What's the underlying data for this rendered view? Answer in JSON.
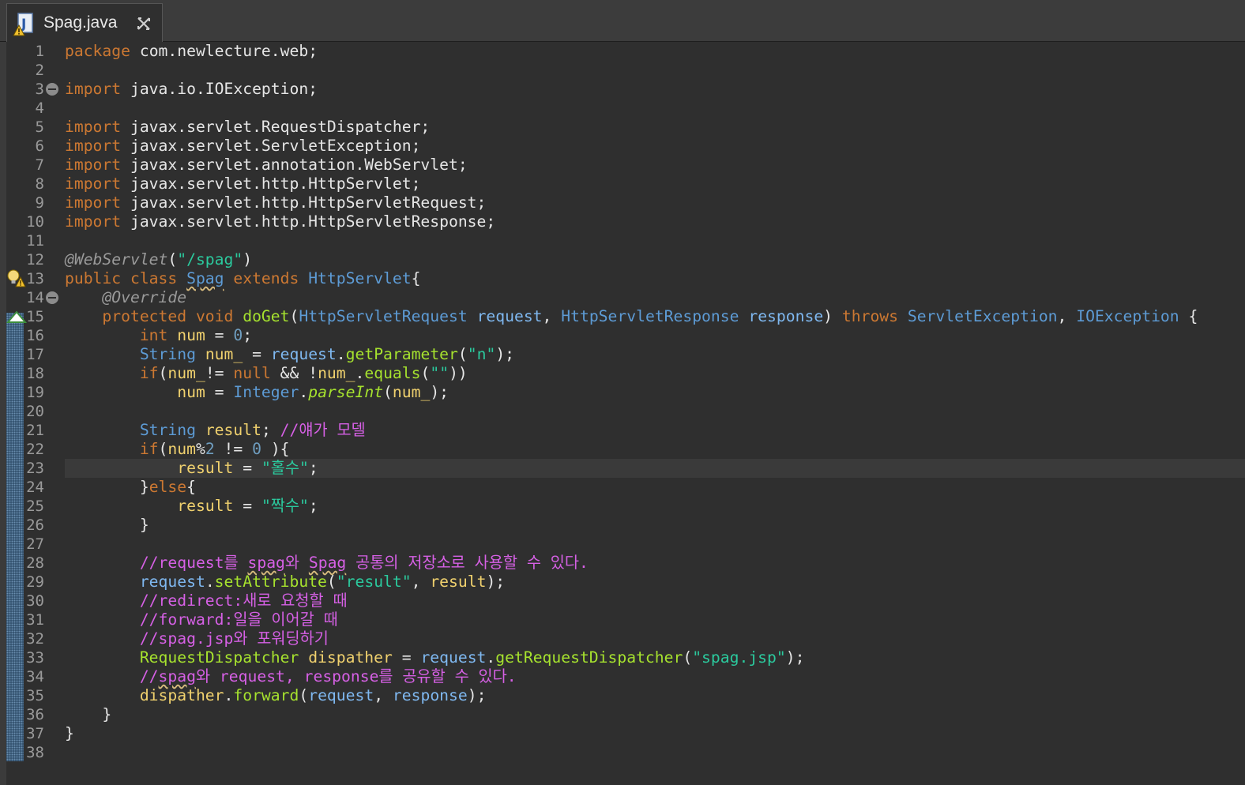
{
  "tab": {
    "title": "Spag.java",
    "icon": "java-file-warning-icon",
    "close_icon": "close-icon"
  },
  "editor": {
    "current_line": 23,
    "lines": [
      {
        "n": "1",
        "segs": [
          {
            "t": "package",
            "c": "kw"
          },
          {
            "t": " com.newlecture.web;",
            "c": ""
          }
        ]
      },
      {
        "n": "2",
        "segs": []
      },
      {
        "n": "3",
        "fold": true,
        "segs": [
          {
            "t": "import",
            "c": "kw"
          },
          {
            "t": " java.io.IOException;",
            "c": ""
          }
        ]
      },
      {
        "n": "4",
        "segs": []
      },
      {
        "n": "5",
        "segs": [
          {
            "t": "import",
            "c": "kw"
          },
          {
            "t": " javax.servlet.RequestDispatcher;",
            "c": ""
          }
        ]
      },
      {
        "n": "6",
        "segs": [
          {
            "t": "import",
            "c": "kw"
          },
          {
            "t": " javax.servlet.ServletException;",
            "c": ""
          }
        ]
      },
      {
        "n": "7",
        "segs": [
          {
            "t": "import",
            "c": "kw"
          },
          {
            "t": " javax.servlet.annotation.WebServlet;",
            "c": ""
          }
        ]
      },
      {
        "n": "8",
        "segs": [
          {
            "t": "import",
            "c": "kw"
          },
          {
            "t": " javax.servlet.http.HttpServlet;",
            "c": ""
          }
        ]
      },
      {
        "n": "9",
        "segs": [
          {
            "t": "import",
            "c": "kw"
          },
          {
            "t": " javax.servlet.http.HttpServletRequest;",
            "c": ""
          }
        ]
      },
      {
        "n": "10",
        "segs": [
          {
            "t": "import",
            "c": "kw"
          },
          {
            "t": " javax.servlet.http.HttpServletResponse;",
            "c": ""
          }
        ]
      },
      {
        "n": "11",
        "segs": []
      },
      {
        "n": "12",
        "segs": [
          {
            "t": "@WebServlet",
            "c": "an"
          },
          {
            "t": "(",
            "c": ""
          },
          {
            "t": "\"/spag\"",
            "c": "st"
          },
          {
            "t": ")",
            "c": ""
          }
        ]
      },
      {
        "n": "13",
        "warn": true,
        "segs": [
          {
            "t": "public class ",
            "c": "kw"
          },
          {
            "t": "Spag",
            "c": "ty ul"
          },
          {
            "t": " extends ",
            "c": "kw"
          },
          {
            "t": "HttpServlet",
            "c": "ty"
          },
          {
            "t": "{",
            "c": ""
          }
        ]
      },
      {
        "n": "14",
        "fold": true,
        "segs": [
          {
            "t": "    ",
            "c": ""
          },
          {
            "t": "@Override",
            "c": "an"
          }
        ]
      },
      {
        "n": "15",
        "override": true,
        "segs": [
          {
            "t": "    ",
            "c": ""
          },
          {
            "t": "protected void ",
            "c": "kw"
          },
          {
            "t": "doGet",
            "c": "fn"
          },
          {
            "t": "(",
            "c": ""
          },
          {
            "t": "HttpServletRequest",
            "c": "ty"
          },
          {
            "t": " ",
            "c": ""
          },
          {
            "t": "request",
            "c": "pa"
          },
          {
            "t": ", ",
            "c": ""
          },
          {
            "t": "HttpServletResponse",
            "c": "ty"
          },
          {
            "t": " ",
            "c": ""
          },
          {
            "t": "response",
            "c": "pa"
          },
          {
            "t": ") ",
            "c": ""
          },
          {
            "t": "throws ",
            "c": "kw"
          },
          {
            "t": "ServletException",
            "c": "ty"
          },
          {
            "t": ", ",
            "c": ""
          },
          {
            "t": "IOException",
            "c": "ty"
          },
          {
            "t": " {",
            "c": ""
          }
        ]
      },
      {
        "n": "16",
        "segs": [
          {
            "t": "        ",
            "c": ""
          },
          {
            "t": "int",
            "c": "kw"
          },
          {
            "t": " ",
            "c": ""
          },
          {
            "t": "num",
            "c": "id"
          },
          {
            "t": " = ",
            "c": ""
          },
          {
            "t": "0",
            "c": "nm"
          },
          {
            "t": ";",
            "c": ""
          }
        ]
      },
      {
        "n": "17",
        "segs": [
          {
            "t": "        ",
            "c": ""
          },
          {
            "t": "String",
            "c": "ty"
          },
          {
            "t": " ",
            "c": ""
          },
          {
            "t": "num_",
            "c": "id"
          },
          {
            "t": " = ",
            "c": ""
          },
          {
            "t": "request",
            "c": "pa"
          },
          {
            "t": ".",
            "c": ""
          },
          {
            "t": "getParameter",
            "c": "fn"
          },
          {
            "t": "(",
            "c": ""
          },
          {
            "t": "\"n\"",
            "c": "st"
          },
          {
            "t": ");",
            "c": ""
          }
        ]
      },
      {
        "n": "18",
        "segs": [
          {
            "t": "        ",
            "c": ""
          },
          {
            "t": "if",
            "c": "kw"
          },
          {
            "t": "(",
            "c": ""
          },
          {
            "t": "num_",
            "c": "id"
          },
          {
            "t": "!= ",
            "c": ""
          },
          {
            "t": "null",
            "c": "kw"
          },
          {
            "t": " && !",
            "c": ""
          },
          {
            "t": "num_",
            "c": "id"
          },
          {
            "t": ".",
            "c": ""
          },
          {
            "t": "equals",
            "c": "fn"
          },
          {
            "t": "(",
            "c": ""
          },
          {
            "t": "\"\"",
            "c": "st"
          },
          {
            "t": "))",
            "c": ""
          }
        ]
      },
      {
        "n": "19",
        "segs": [
          {
            "t": "            ",
            "c": ""
          },
          {
            "t": "num",
            "c": "id"
          },
          {
            "t": " = ",
            "c": ""
          },
          {
            "t": "Integer",
            "c": "ty"
          },
          {
            "t": ".",
            "c": ""
          },
          {
            "t": "parseInt",
            "c": "fn it"
          },
          {
            "t": "(",
            "c": ""
          },
          {
            "t": "num_",
            "c": "id"
          },
          {
            "t": ");",
            "c": ""
          }
        ]
      },
      {
        "n": "20",
        "segs": []
      },
      {
        "n": "21",
        "segs": [
          {
            "t": "        ",
            "c": ""
          },
          {
            "t": "String",
            "c": "ty"
          },
          {
            "t": " ",
            "c": ""
          },
          {
            "t": "result",
            "c": "id"
          },
          {
            "t": "; ",
            "c": ""
          },
          {
            "t": "//얘가 모델",
            "c": "cm"
          }
        ]
      },
      {
        "n": "22",
        "segs": [
          {
            "t": "        ",
            "c": ""
          },
          {
            "t": "if",
            "c": "kw"
          },
          {
            "t": "(",
            "c": ""
          },
          {
            "t": "num",
            "c": "id"
          },
          {
            "t": "%",
            "c": ""
          },
          {
            "t": "2",
            "c": "nm"
          },
          {
            "t": " != ",
            "c": ""
          },
          {
            "t": "0",
            "c": "nm"
          },
          {
            "t": " ){",
            "c": ""
          }
        ]
      },
      {
        "n": "23",
        "segs": [
          {
            "t": "            ",
            "c": ""
          },
          {
            "t": "result",
            "c": "id"
          },
          {
            "t": " = ",
            "c": ""
          },
          {
            "t": "\"홀수\"",
            "c": "st"
          },
          {
            "t": ";",
            "c": ""
          }
        ]
      },
      {
        "n": "24",
        "segs": [
          {
            "t": "        }",
            "c": ""
          },
          {
            "t": "else",
            "c": "kw"
          },
          {
            "t": "{",
            "c": ""
          }
        ]
      },
      {
        "n": "25",
        "segs": [
          {
            "t": "            ",
            "c": ""
          },
          {
            "t": "result",
            "c": "id"
          },
          {
            "t": " = ",
            "c": ""
          },
          {
            "t": "\"짝수\"",
            "c": "st"
          },
          {
            "t": ";",
            "c": ""
          }
        ]
      },
      {
        "n": "26",
        "segs": [
          {
            "t": "        }",
            "c": ""
          }
        ]
      },
      {
        "n": "27",
        "segs": []
      },
      {
        "n": "28",
        "segs": [
          {
            "t": "        ",
            "c": ""
          },
          {
            "t": "//request를 ",
            "c": "cm"
          },
          {
            "t": "spag",
            "c": "cm ul"
          },
          {
            "t": "와 ",
            "c": "cm"
          },
          {
            "t": "Spag",
            "c": "cm ul"
          },
          {
            "t": " 공통의 저장소로 사용할 수 있다.",
            "c": "cm"
          }
        ]
      },
      {
        "n": "29",
        "segs": [
          {
            "t": "        ",
            "c": ""
          },
          {
            "t": "request",
            "c": "pa"
          },
          {
            "t": ".",
            "c": ""
          },
          {
            "t": "setAttribute",
            "c": "fn"
          },
          {
            "t": "(",
            "c": ""
          },
          {
            "t": "\"result\"",
            "c": "st"
          },
          {
            "t": ", ",
            "c": ""
          },
          {
            "t": "result",
            "c": "id"
          },
          {
            "t": ");",
            "c": ""
          }
        ]
      },
      {
        "n": "30",
        "segs": [
          {
            "t": "        ",
            "c": ""
          },
          {
            "t": "//redirect:새로 요청할 때",
            "c": "cm"
          }
        ]
      },
      {
        "n": "31",
        "segs": [
          {
            "t": "        ",
            "c": ""
          },
          {
            "t": "//forward:일을 이어갈 때",
            "c": "cm"
          }
        ]
      },
      {
        "n": "32",
        "segs": [
          {
            "t": "        ",
            "c": ""
          },
          {
            "t": "//spag.jsp와 포워딩하기",
            "c": "cm"
          }
        ]
      },
      {
        "n": "33",
        "segs": [
          {
            "t": "        ",
            "c": ""
          },
          {
            "t": "RequestDispatcher",
            "c": "fn"
          },
          {
            "t": " ",
            "c": ""
          },
          {
            "t": "dispather",
            "c": "id"
          },
          {
            "t": " = ",
            "c": ""
          },
          {
            "t": "request",
            "c": "pa"
          },
          {
            "t": ".",
            "c": ""
          },
          {
            "t": "getRequestDispatcher",
            "c": "fn"
          },
          {
            "t": "(",
            "c": ""
          },
          {
            "t": "\"spag.jsp\"",
            "c": "st"
          },
          {
            "t": ");",
            "c": ""
          }
        ]
      },
      {
        "n": "34",
        "segs": [
          {
            "t": "        ",
            "c": ""
          },
          {
            "t": "//",
            "c": "cm"
          },
          {
            "t": "spag",
            "c": "cm ul"
          },
          {
            "t": "와 request, response를 공유할 수 있다.",
            "c": "cm"
          }
        ]
      },
      {
        "n": "35",
        "segs": [
          {
            "t": "        ",
            "c": ""
          },
          {
            "t": "dispather",
            "c": "id"
          },
          {
            "t": ".",
            "c": ""
          },
          {
            "t": "forward",
            "c": "fn"
          },
          {
            "t": "(",
            "c": ""
          },
          {
            "t": "request",
            "c": "pa"
          },
          {
            "t": ", ",
            "c": ""
          },
          {
            "t": "response",
            "c": "pa"
          },
          {
            "t": ");",
            "c": ""
          }
        ]
      },
      {
        "n": "36",
        "segs": [
          {
            "t": "    }",
            "c": ""
          }
        ]
      },
      {
        "n": "37",
        "segs": [
          {
            "t": "}",
            "c": ""
          }
        ]
      },
      {
        "n": "38",
        "segs": []
      }
    ]
  }
}
